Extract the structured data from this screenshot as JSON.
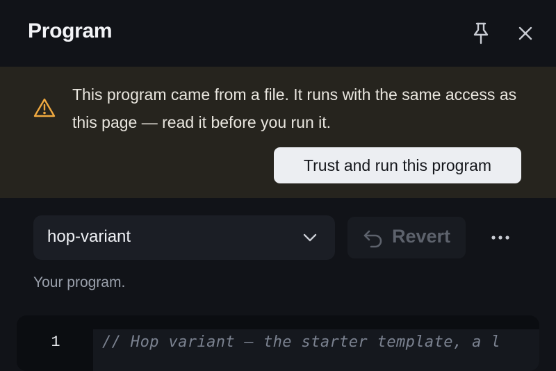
{
  "header": {
    "title": "Program",
    "icons": {
      "pin": "pin-icon",
      "close": "close-icon"
    }
  },
  "warning": {
    "icon": "warning-triangle-icon",
    "message": "This program came from a file. It runs with the same access as this page — read it before you run it.",
    "trust_button_label": "Trust and run this program"
  },
  "program": {
    "selected": "hop-variant",
    "revert_label": "Revert",
    "revert_enabled": false,
    "more_icon": "more-horizontal-icon",
    "hint": "Your program."
  },
  "editor": {
    "lines": [
      {
        "number": "1",
        "text": "// Hop variant — the starter template, a l"
      }
    ]
  },
  "colors": {
    "background": "#111318",
    "warning_background": "#26241e",
    "warning_icon": "#f0a940",
    "button_light": "#eceef2"
  }
}
